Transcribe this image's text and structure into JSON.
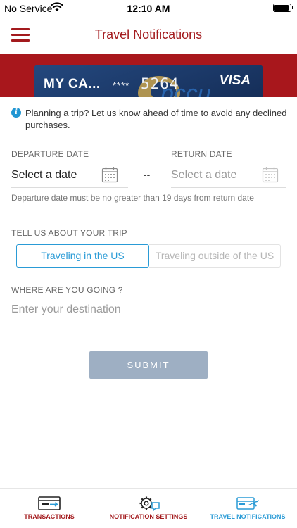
{
  "status_bar": {
    "carrier": "No Service",
    "time": "12:10 AM"
  },
  "nav": {
    "title": "Travel Notifications",
    "menu_icon": "hamburger-menu-icon"
  },
  "card": {
    "name": "MY CA...",
    "masked": "****",
    "last_digits": "5264",
    "network": "VISA",
    "logo_text": "pccu"
  },
  "info": {
    "icon": "info-icon",
    "text": "Planning a trip? Let us know ahead of time to avoid any declined purchases."
  },
  "dates": {
    "departure_label": "DEPARTURE DATE",
    "departure_value": "Select a date",
    "separator": "--",
    "return_label": "RETURN DATE",
    "return_value": "Select a date",
    "calendar_icon": "calendar-icon",
    "hint": "Departure date must be no greater than 19 days from return date"
  },
  "trip": {
    "label": "TELL US ABOUT YOUR TRIP",
    "options": [
      "Traveling in the US",
      "Traveling outside of the US"
    ],
    "selected": "Traveling in the US"
  },
  "destination": {
    "label": "WHERE ARE YOU GOING ?",
    "placeholder": "Enter your destination",
    "value": ""
  },
  "submit": {
    "label": "SUBMIT"
  },
  "bottom_tabs": [
    {
      "label": "TRANSACTIONS",
      "icon": "credit-card-icon",
      "active": false
    },
    {
      "label": "NOTIFICATION SETTINGS",
      "icon": "gear-chat-icon",
      "active": false
    },
    {
      "label": "TRAVEL NOTIFICATIONS",
      "icon": "card-plane-icon",
      "active": true
    }
  ],
  "colors": {
    "brand_red": "#a31a1d",
    "accent_blue": "#2a9bd6",
    "submit_disabled": "#9eafc3",
    "tab_inactive_label": "#a31a1d",
    "tab_active_label": "#2a9bd6"
  }
}
